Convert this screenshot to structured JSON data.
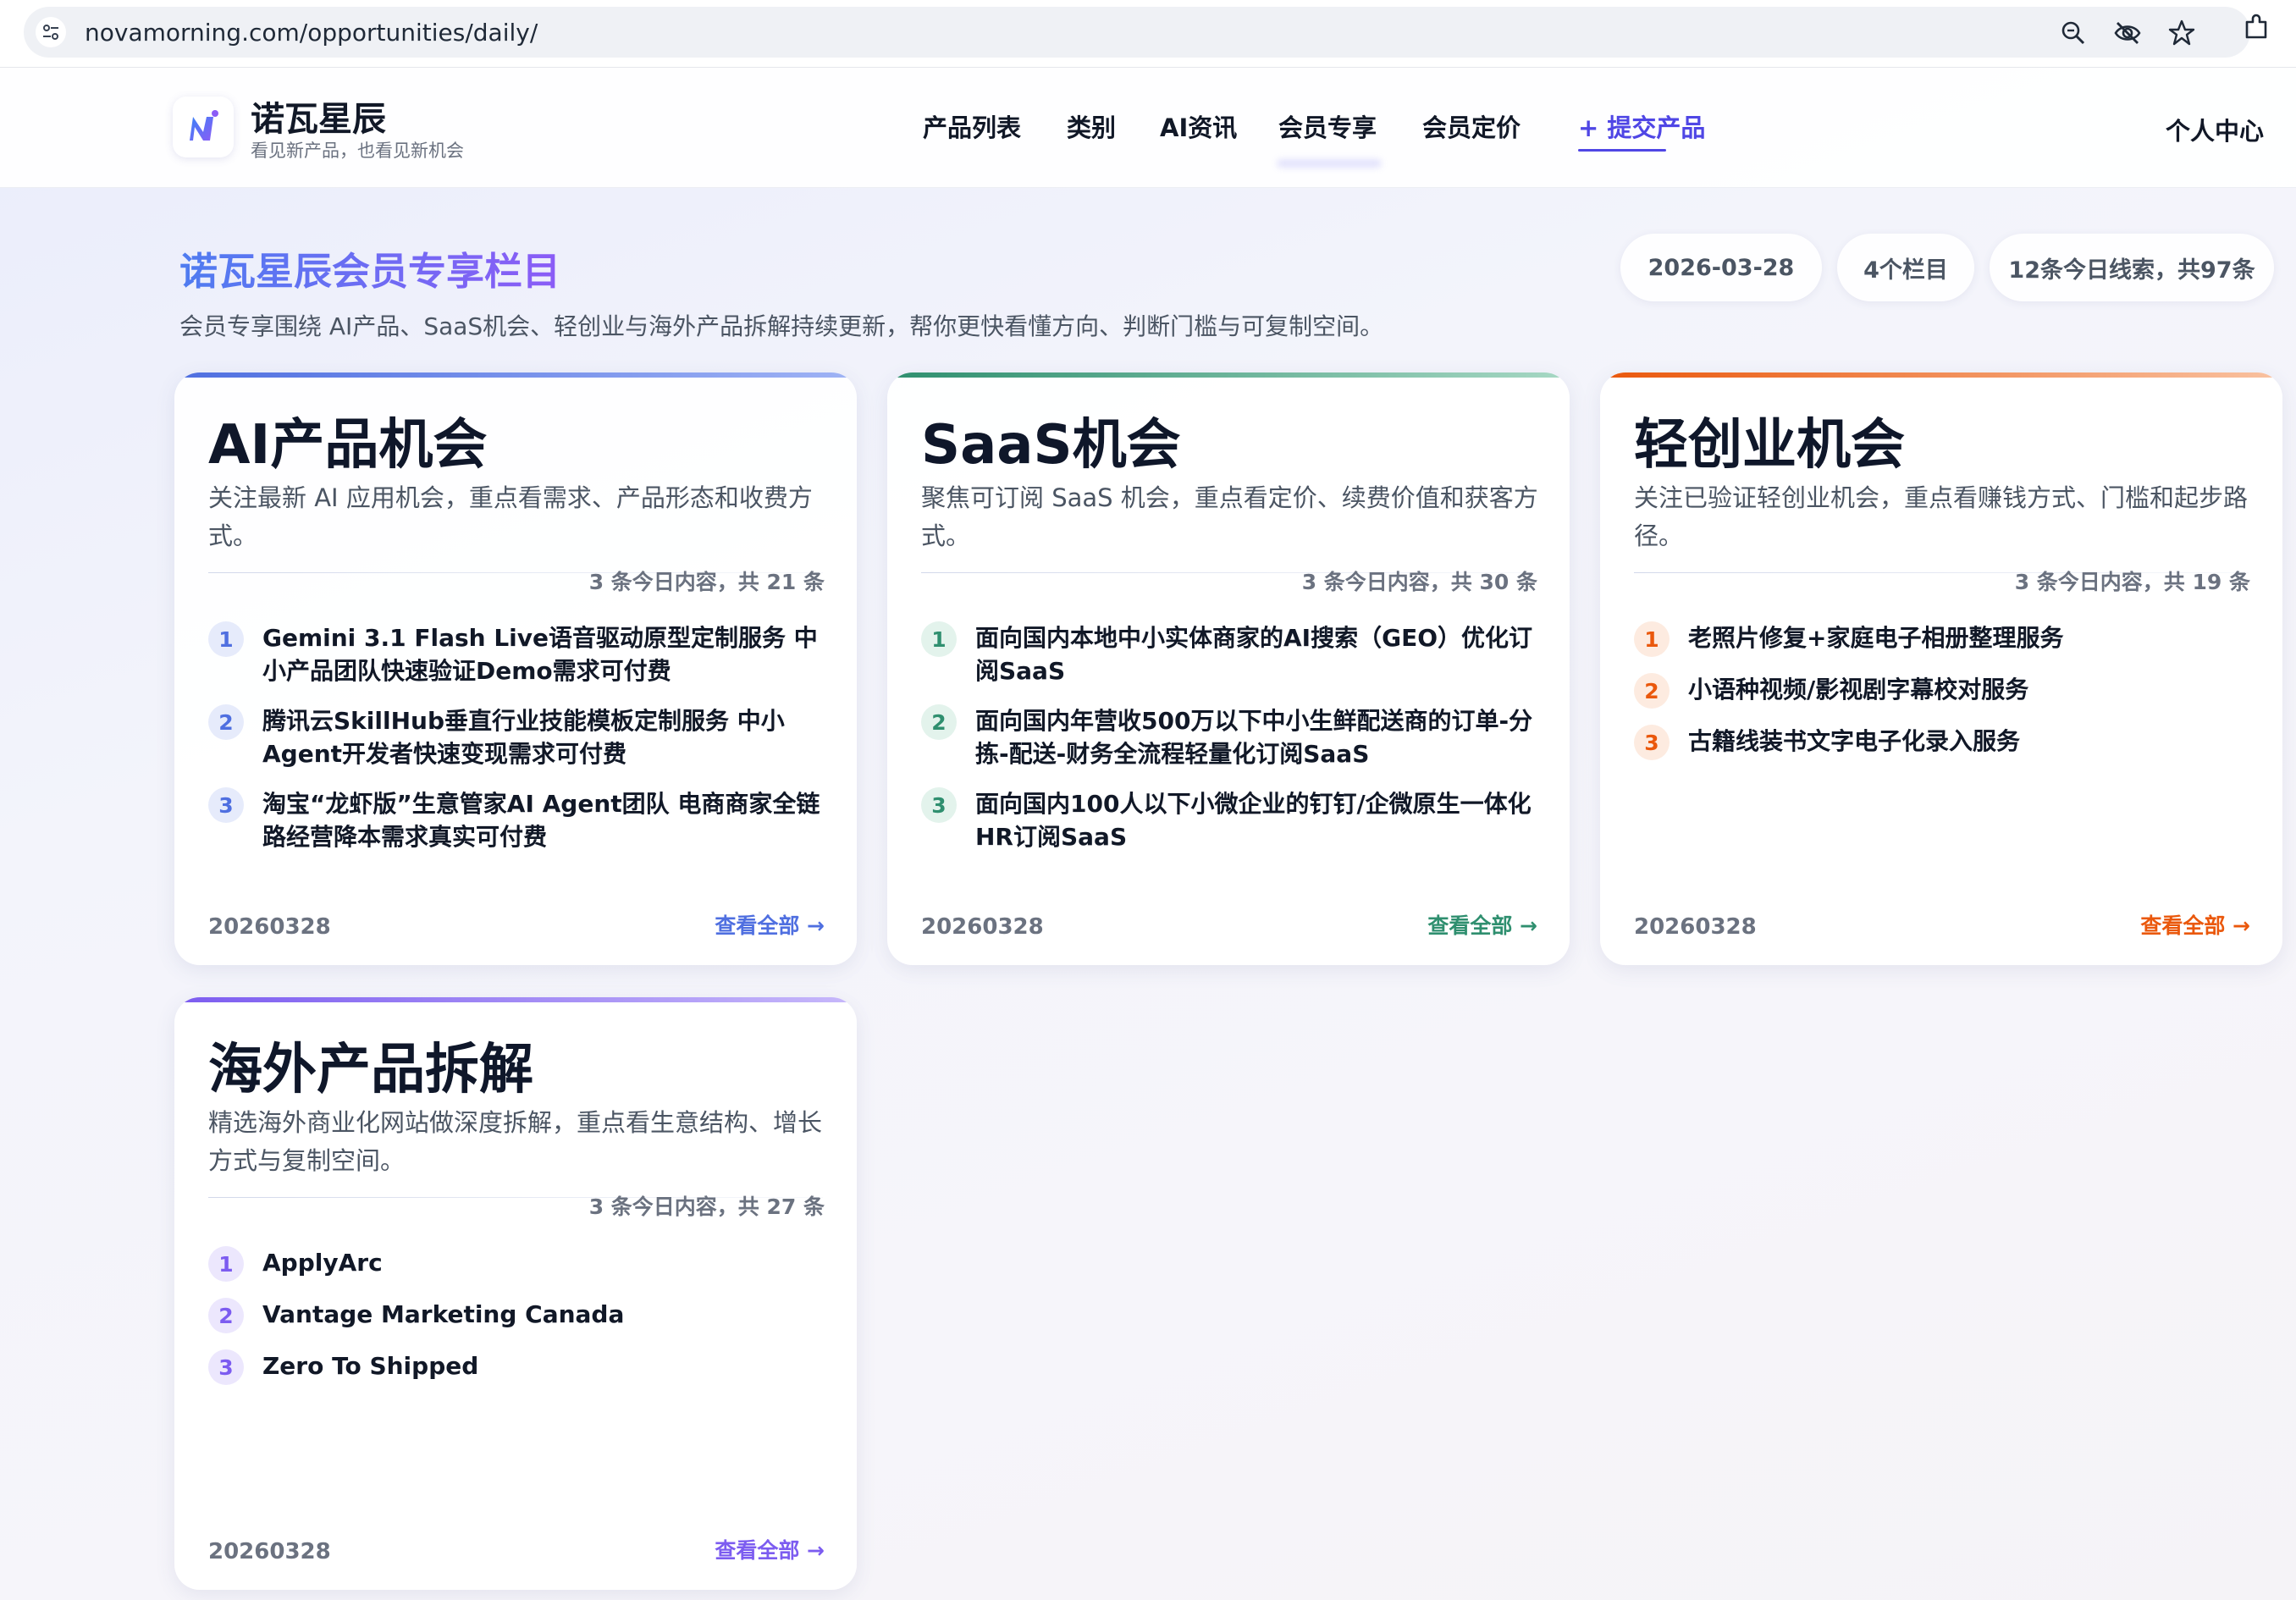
{
  "browser": {
    "url": "novamorning.com/opportunities/daily/",
    "icons": [
      "site-settings-icon",
      "zoom-icon",
      "eye-off-icon",
      "star-icon",
      "extensions-icon"
    ]
  },
  "header": {
    "brand_name": "诺瓦星辰",
    "brand_tagline": "看见新产品，也看见新机会",
    "nav": {
      "products": "产品列表",
      "categories": "类别",
      "ai_news": "AI资讯",
      "members": "会员专享",
      "pricing": "会员定价",
      "submit": "+ 提交产品"
    },
    "user_center": "个人中心"
  },
  "section": {
    "title": "诺瓦星辰会员专享栏目",
    "description": "会员专享围绕 AI产品、SaaS机会、轻创业与海外产品拆解持续更新，帮你更快看懂方向、判断门槛与可复制空间。",
    "pill_date": "2026-03-28",
    "pill_columns": "4个栏目",
    "pill_leads": "12条今日线索，共97条"
  },
  "colors": {
    "ai_accent": "#4f6fe0",
    "saas_accent": "#2f8f6f",
    "light_accent": "#ea580c",
    "overseas_accent": "#7c5cf0"
  },
  "cards": {
    "ai": {
      "title": "AI产品机会",
      "description": "关注最新 AI 应用机会，重点看需求、产品形态和收费方式。",
      "count": "3 条今日内容，共 21 条",
      "items": [
        {
          "num": "1",
          "text": "Gemini 3.1 Flash Live语音驱动原型定制服务 中小产品团队快速验证Demo需求可付费"
        },
        {
          "num": "2",
          "text": "腾讯云SkillHub垂直行业技能模板定制服务 中小Agent开发者快速变现需求可付费"
        },
        {
          "num": "3",
          "text": "淘宝“龙虾版”生意管家AI Agent团队 电商商家全链路经营降本需求真实可付费"
        }
      ],
      "date": "20260328",
      "link": "查看全部 →"
    },
    "saas": {
      "title": "SaaS机会",
      "description": "聚焦可订阅 SaaS 机会，重点看定价、续费价值和获客方式。",
      "count": "3 条今日内容，共 30 条",
      "items": [
        {
          "num": "1",
          "text": "面向国内本地中小实体商家的AI搜索（GEO）优化订阅SaaS"
        },
        {
          "num": "2",
          "text": "面向国内年营收500万以下中小生鲜配送商的订单-分拣-配送-财务全流程轻量化订阅SaaS"
        },
        {
          "num": "3",
          "text": "面向国内100人以下小微企业的钉钉/企微原生一体化HR订阅SaaS"
        }
      ],
      "date": "20260328",
      "link": "查看全部 →"
    },
    "light": {
      "title": "轻创业机会",
      "description": "关注已验证轻创业机会，重点看赚钱方式、门槛和起步路径。",
      "count": "3 条今日内容，共 19 条",
      "items": [
        {
          "num": "1",
          "text": "老照片修复+家庭电子相册整理服务"
        },
        {
          "num": "2",
          "text": "小语种视频/影视剧字幕校对服务"
        },
        {
          "num": "3",
          "text": "古籍线装书文字电子化录入服务"
        }
      ],
      "date": "20260328",
      "link": "查看全部 →"
    },
    "overseas": {
      "title": "海外产品拆解",
      "description": "精选海外商业化网站做深度拆解，重点看生意结构、增长方式与复制空间。",
      "count": "3 条今日内容，共 27 条",
      "items": [
        {
          "num": "1",
          "text": "ApplyArc"
        },
        {
          "num": "2",
          "text": "Vantage Marketing Canada"
        },
        {
          "num": "3",
          "text": "Zero To Shipped"
        }
      ],
      "date": "20260328",
      "link": "查看全部 →"
    }
  }
}
